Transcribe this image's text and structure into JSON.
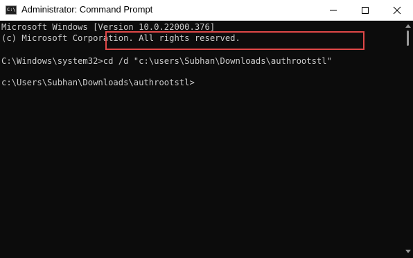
{
  "window": {
    "title": "Administrator: Command Prompt",
    "app_icon_text": "C:\\",
    "colors": {
      "titlebar_bg": "#ffffff",
      "console_bg": "#0c0c0c",
      "console_text": "#cccccc",
      "highlight_border": "#e04848"
    }
  },
  "console": {
    "lines": [
      "Microsoft Windows [Version 10.0.22000.376]",
      "(c) Microsoft Corporation. All rights reserved.",
      "",
      "C:\\Windows\\system32>cd /d \"c:\\users\\Subhan\\Downloads\\authrootstl\"",
      "",
      "c:\\Users\\Subhan\\Downloads\\authrootstl>"
    ],
    "highlighted_command": "cd /d \"c:\\users\\Subhan\\Downloads\\authrootstl\""
  },
  "icons": {
    "minimize": "minimize-icon",
    "maximize": "maximize-icon",
    "close": "close-icon"
  }
}
